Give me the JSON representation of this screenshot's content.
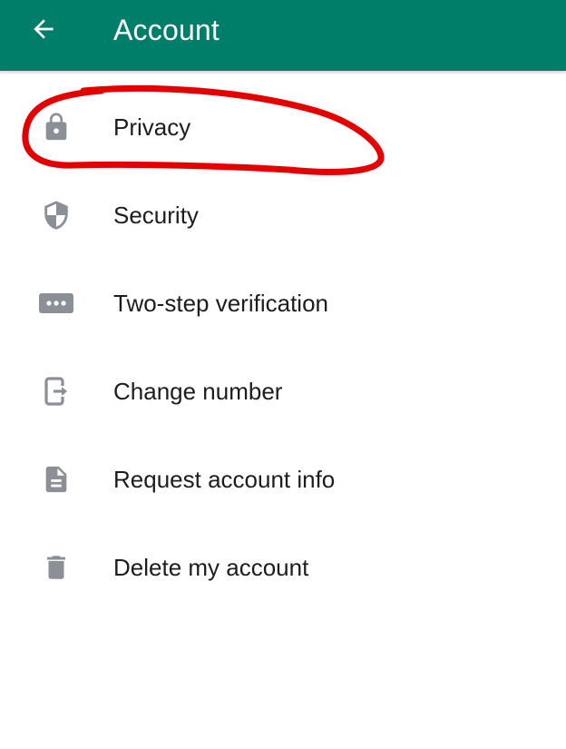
{
  "header": {
    "title": "Account",
    "back_icon": "arrow-left-icon",
    "background_color": "#007E69"
  },
  "menu": {
    "items": [
      {
        "label": "Privacy",
        "icon": "lock-icon"
      },
      {
        "label": "Security",
        "icon": "shield-icon"
      },
      {
        "label": "Two-step verification",
        "icon": "dots-password-icon"
      },
      {
        "label": "Change number",
        "icon": "phone-change-icon"
      },
      {
        "label": "Request account info",
        "icon": "document-icon"
      },
      {
        "label": "Delete my account",
        "icon": "trash-icon"
      }
    ]
  },
  "annotation": {
    "type": "hand-drawn-circle",
    "target": "Privacy",
    "color": "#E50000"
  },
  "colors": {
    "icon": "#8A9096",
    "text": "#1d1d1d"
  }
}
